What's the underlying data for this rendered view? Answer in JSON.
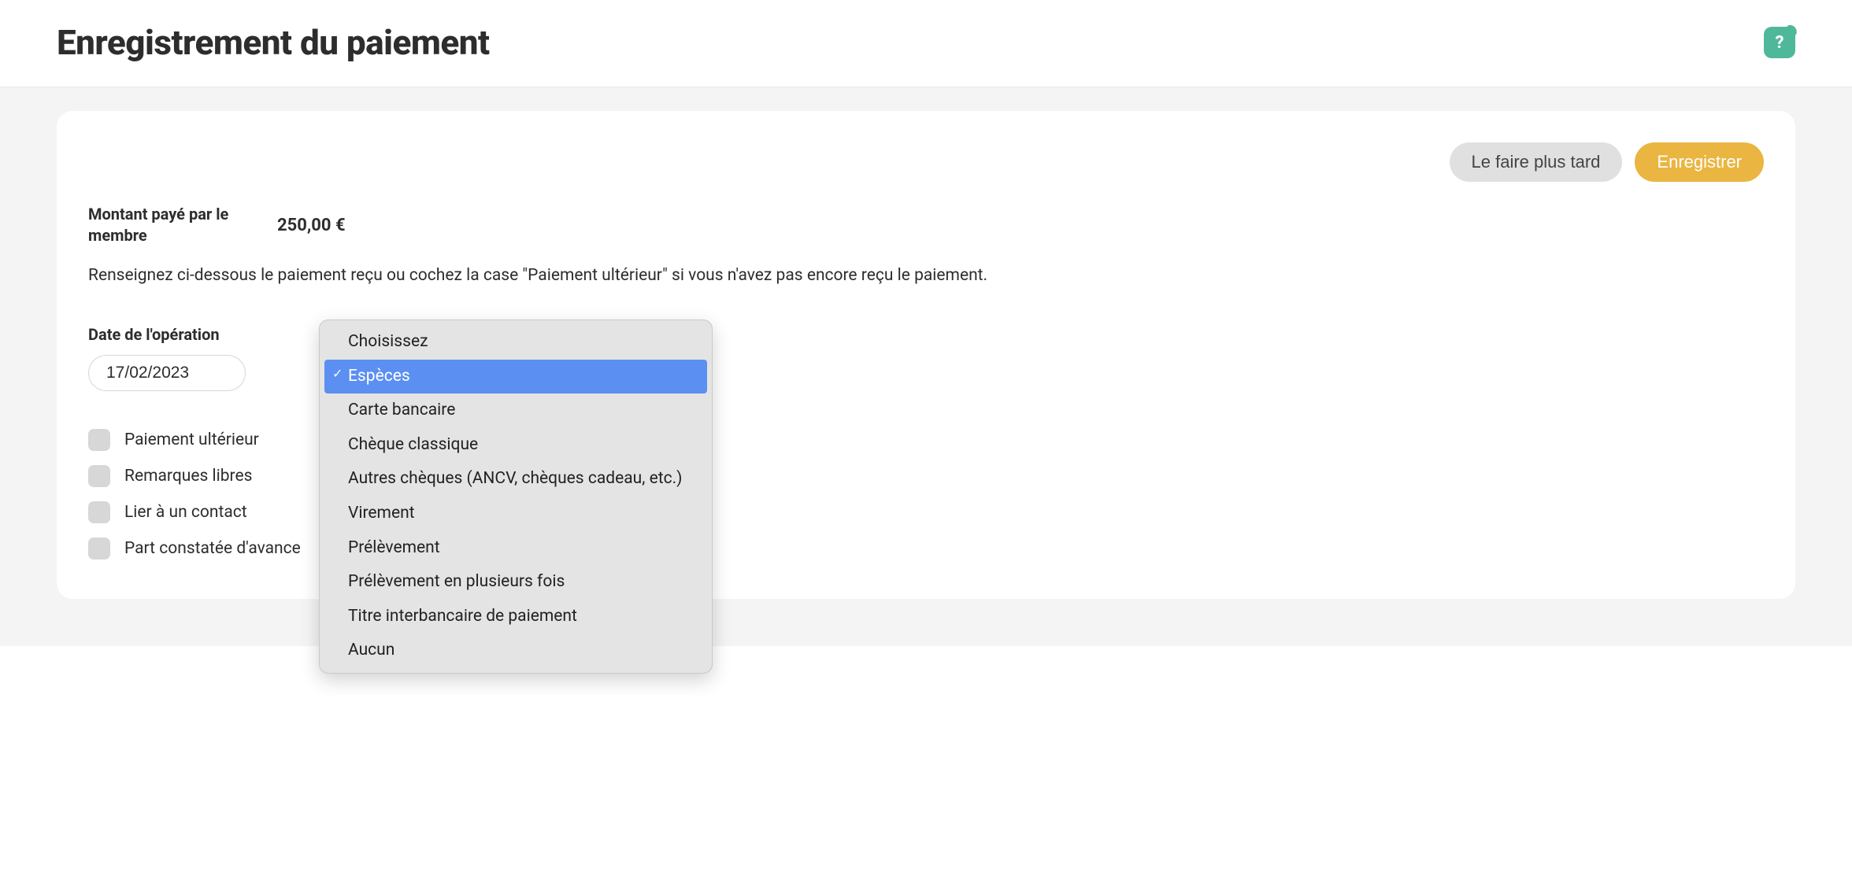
{
  "header": {
    "title": "Enregistrement du paiement",
    "help_label": "?"
  },
  "actions": {
    "later": "Le faire plus tard",
    "save": "Enregistrer"
  },
  "amount": {
    "label": "Montant payé par le membre",
    "value": "250,00 €"
  },
  "instruction": "Renseignez ci-dessous le paiement reçu ou cochez la case \"Paiement ultérieur\" si vous n'avez pas encore reçu le paiement.",
  "date": {
    "label": "Date de l'opération",
    "value": "17/02/2023"
  },
  "checkboxes": {
    "later": "Paiement ultérieur",
    "remarks": "Remarques libres",
    "link_contact": "Lier à un contact",
    "advance": "Part constatée d'avance"
  },
  "dropdown": {
    "options": [
      "Choisissez",
      "Espèces",
      "Carte bancaire",
      "Chèque classique",
      "Autres chèques (ANCV, chèques cadeau, etc.)",
      "Virement",
      "Prélèvement",
      "Prélèvement en plusieurs fois",
      "Titre interbancaire de paiement",
      "Aucun"
    ],
    "selected_index": 1
  }
}
